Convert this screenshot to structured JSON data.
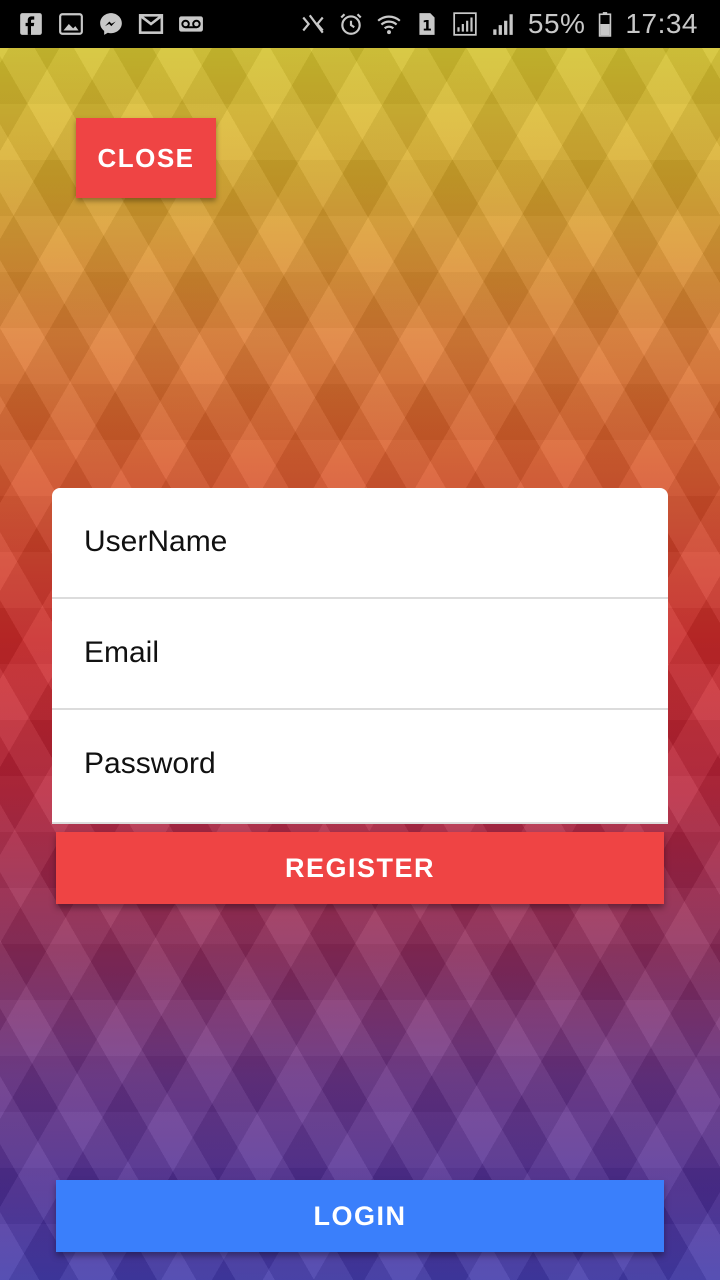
{
  "status_bar": {
    "left_icons": [
      "facebook-icon",
      "image-icon",
      "messenger-icon",
      "gmail-icon",
      "voicemail-icon"
    ],
    "right_icons": [
      "nfc-icon",
      "alarm-icon",
      "wifi-icon",
      "sim-1-icon",
      "signal-icon",
      "signal-icon-2",
      "battery-icon"
    ],
    "battery": "55%",
    "time": "17:34"
  },
  "close_button": {
    "label": "CLOSE"
  },
  "form": {
    "username": {
      "placeholder": "UserName",
      "value": ""
    },
    "email": {
      "placeholder": "Email",
      "value": ""
    },
    "password": {
      "placeholder": "Password",
      "value": ""
    }
  },
  "register_button": {
    "label": "REGISTER"
  },
  "login_button": {
    "label": "LOGIN"
  },
  "colors": {
    "danger": "#ef4444",
    "primary": "#3a7ffb",
    "card": "#ffffff"
  }
}
